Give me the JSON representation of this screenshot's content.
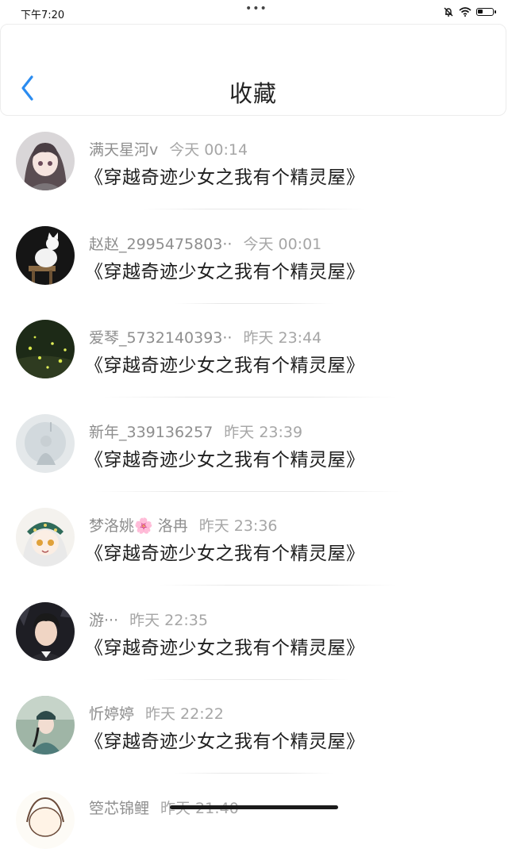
{
  "status_bar": {
    "time": "下午7:20",
    "dots": "•••",
    "battery_level": 0.35
  },
  "header": {
    "title": "收藏"
  },
  "items": [
    {
      "user": "满天星河v",
      "time": "今天 00:14",
      "title": "《穿越奇迹少女之我有个精灵屋》"
    },
    {
      "user": "赵赵_2995475803··",
      "time": "今天 00:01",
      "title": "《穿越奇迹少女之我有个精灵屋》"
    },
    {
      "user": "爱琴_5732140393··",
      "time": "昨天 23:44",
      "title": "《穿越奇迹少女之我有个精灵屋》"
    },
    {
      "user": "新年_339136257",
      "time": "昨天 23:39",
      "title": "《穿越奇迹少女之我有个精灵屋》"
    },
    {
      "user": "梦洛姚🌸 洛冉",
      "time": "昨天 23:36",
      "title": "《穿越奇迹少女之我有个精灵屋》"
    },
    {
      "user": "游···",
      "time": "昨天 22:35",
      "title": "《穿越奇迹少女之我有个精灵屋》"
    },
    {
      "user": "忻婷婷",
      "time": "昨天 22:22",
      "title": "《穿越奇迹少女之我有个精灵屋》"
    },
    {
      "user": "箜芯锦鲤",
      "time": "昨天 21:40",
      "title": ""
    }
  ]
}
